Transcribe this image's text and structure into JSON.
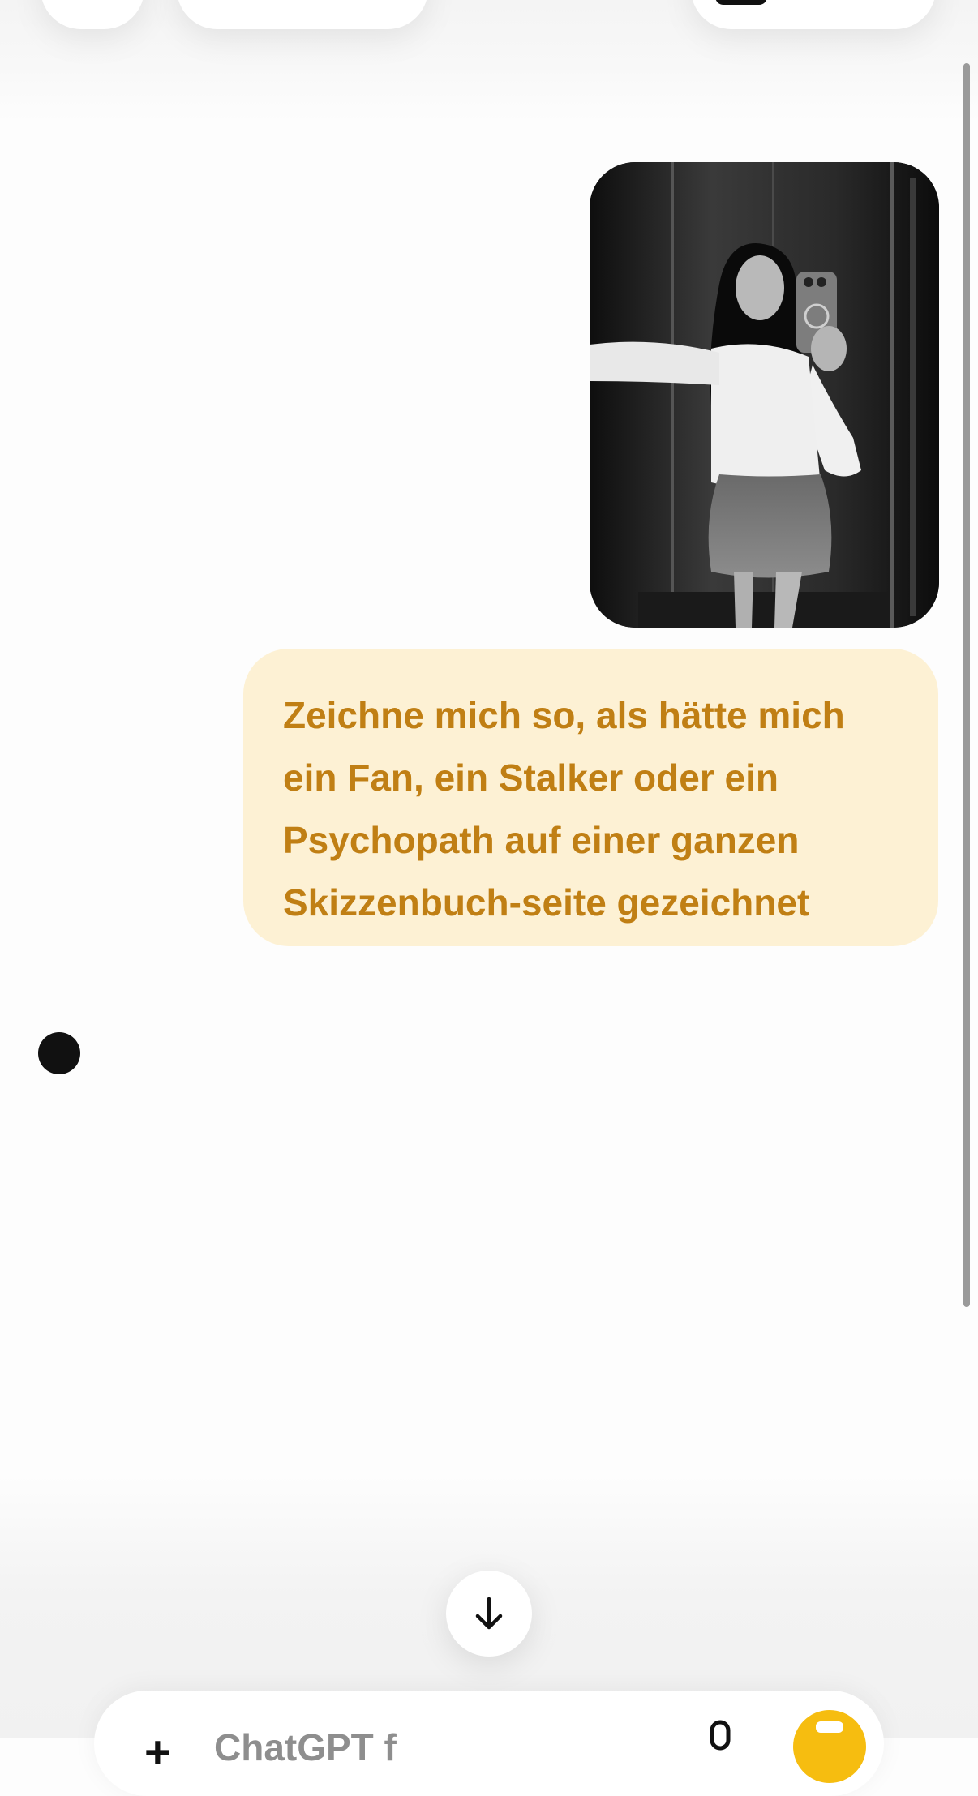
{
  "header": {
    "left_button": "",
    "title_button": "",
    "right_button": ""
  },
  "conversation": {
    "user_image": {
      "description_name": "user-uploaded-selfie",
      "tone": "black-and-white"
    },
    "user_message": "Zeichne mich so, als hätte mich\nein Fan, ein Stalker oder ein\nPsychopath auf einer ganzen\nSkizzenbuch-seite gezeichnet",
    "assistant_status": "generating"
  },
  "controls": {
    "scroll_down_icon": "arrow-down-icon"
  },
  "composer": {
    "add_icon": "+",
    "placeholder": "ChatGPT f",
    "mic_icon": "microphone-icon",
    "send_icon": "voice-mode-icon"
  },
  "colors": {
    "bubble_background": "#fdf1d4",
    "bubble_text": "#c07f14",
    "accent": "#f6bd10",
    "background": "#fdfdfd"
  }
}
